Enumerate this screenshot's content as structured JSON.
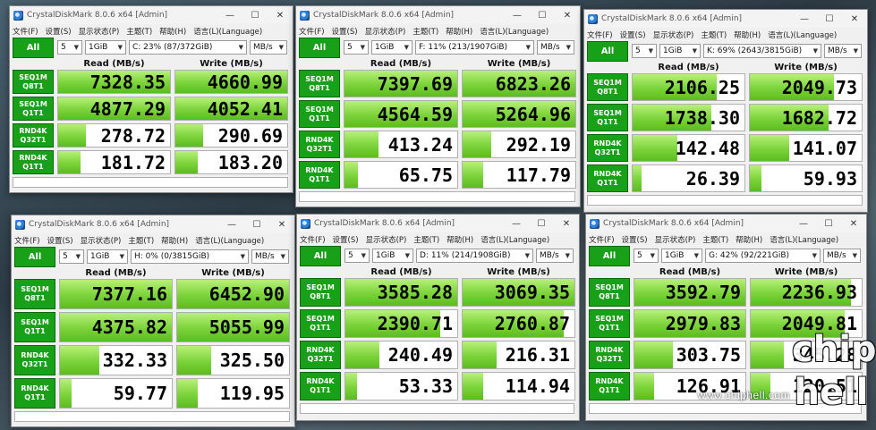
{
  "menu": [
    "文件(F)",
    "设置(S)",
    "显示状态(P)",
    "主题(T)",
    "帮助(H)",
    "语言(L)(Language)"
  ],
  "all_label": "All",
  "read_header": "Read (MB/s)",
  "write_header": "Write (MB/s)",
  "unit": "MB/s",
  "count": "5",
  "size": "1GiB",
  "tests": [
    {
      "l1": "SEQ1M",
      "l2": "Q8T1"
    },
    {
      "l1": "SEQ1M",
      "l2": "Q1T1"
    },
    {
      "l1": "RND4K",
      "l2": "Q32T1"
    },
    {
      "l1": "RND4K",
      "l2": "Q1T1"
    }
  ],
  "windows": [
    {
      "title": "CrystalDiskMark 8.0.6 x64 [Admin]",
      "drive": "C: 23% (87/372GiB)",
      "read": [
        "7328.35",
        "4877.29",
        "278.72",
        "181.72"
      ],
      "write": [
        "4660.99",
        "4052.41",
        "290.69",
        "183.20"
      ],
      "read_fill": [
        1.0,
        1.0,
        0.25,
        0.2
      ],
      "write_fill": [
        1.0,
        1.0,
        0.25,
        0.2
      ]
    },
    {
      "title": "CrystalDiskMark 8.0.6 x64 [Admin]",
      "drive": "F: 11% (213/1907GiB)",
      "read": [
        "7397.69",
        "4564.59",
        "413.24",
        "65.75"
      ],
      "write": [
        "6823.26",
        "5264.96",
        "292.19",
        "117.79"
      ],
      "read_fill": [
        1.0,
        1.0,
        0.3,
        0.12
      ],
      "write_fill": [
        1.0,
        1.0,
        0.25,
        0.18
      ]
    },
    {
      "title": "CrystalDiskMark 8.0.6 x64 [Admin]",
      "drive": "K: 69% (2643/3815GiB)",
      "read": [
        "2106.25",
        "1738.30",
        "142.48",
        "26.39"
      ],
      "write": [
        "2049.73",
        "1682.72",
        "141.07",
        "59.93"
      ],
      "read_fill": [
        0.75,
        0.7,
        0.4,
        0.08
      ],
      "write_fill": [
        0.75,
        0.7,
        0.35,
        0.1
      ]
    },
    {
      "title": "CrystalDiskMark 8.0.6 x64 [Admin]",
      "drive": "H: 0% (0/3815GiB)",
      "read": [
        "7377.16",
        "4375.82",
        "332.33",
        "59.77"
      ],
      "write": [
        "6452.90",
        "5055.99",
        "325.50",
        "119.95"
      ],
      "read_fill": [
        1.0,
        1.0,
        0.35,
        0.1
      ],
      "write_fill": [
        1.0,
        1.0,
        0.3,
        0.18
      ]
    },
    {
      "title": "CrystalDiskMark 8.0.6 x64 [Admin]",
      "drive": "D: 11% (214/1908GiB)",
      "read": [
        "3585.28",
        "2390.71",
        "240.49",
        "53.33"
      ],
      "write": [
        "3069.35",
        "2760.87",
        "216.31",
        "114.94"
      ],
      "read_fill": [
        1.0,
        0.85,
        0.3,
        0.1
      ],
      "write_fill": [
        1.0,
        0.9,
        0.3,
        0.18
      ]
    },
    {
      "title": "CrystalDiskMark 8.0.6 x64 [Admin]",
      "drive": "G: 42% (92/221GiB)",
      "read": [
        "3592.79",
        "2979.83",
        "303.75",
        "126.91"
      ],
      "write": [
        "2236.93",
        "2049.81",
        "345.28",
        "120.51"
      ],
      "read_fill": [
        1.0,
        1.0,
        0.35,
        0.18
      ],
      "write_fill": [
        0.9,
        0.85,
        0.3,
        0.18
      ]
    }
  ],
  "watermark": "www.chiphell.com",
  "watermark_logo": "chip hell"
}
